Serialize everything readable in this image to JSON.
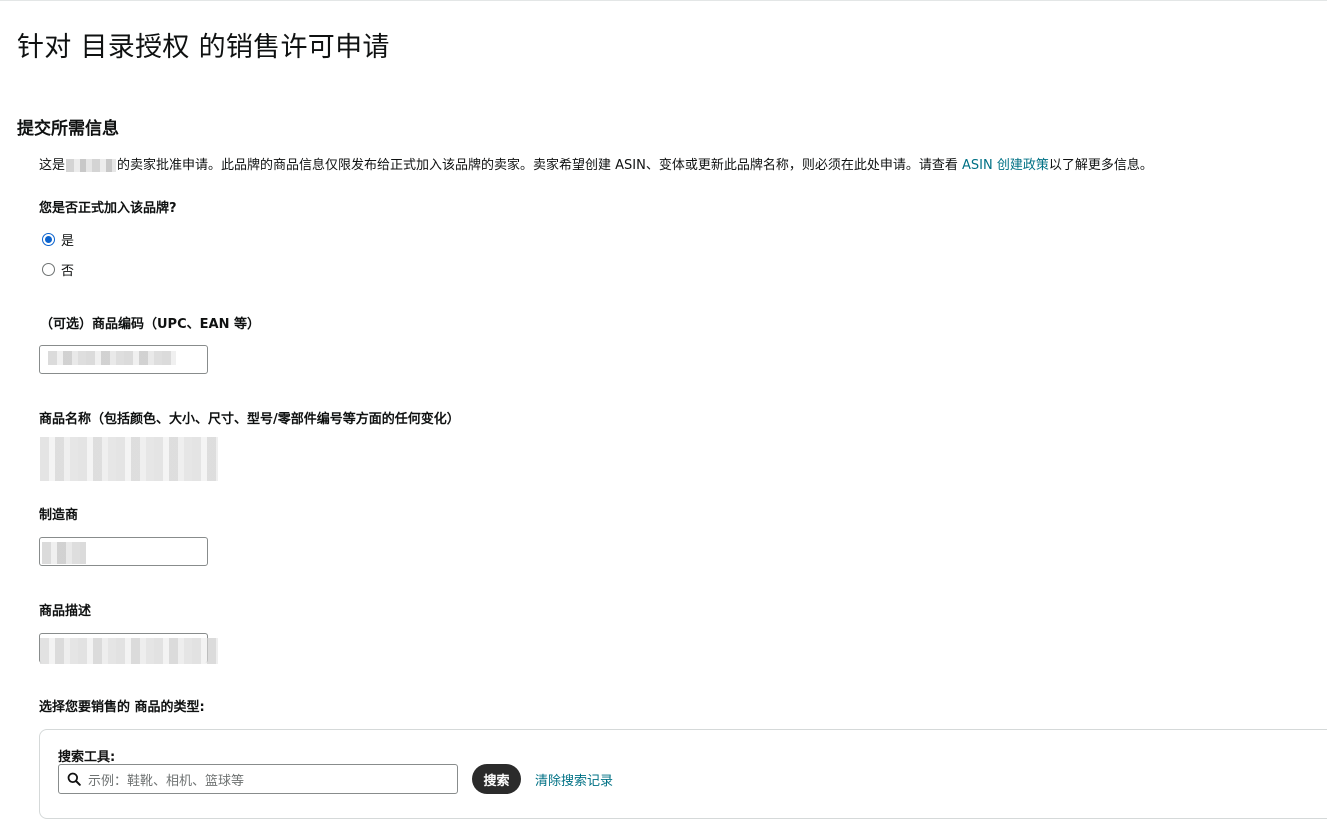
{
  "page": {
    "title": "针对 目录授权 的销售许可申请",
    "section_title": "提交所需信息"
  },
  "intro": {
    "prefix": "这是",
    "middle": "的卖家批准申请。此品牌的商品信息仅限发布给正式加入该品牌的卖家。卖家希望创建 ASIN、变体或更新此品牌名称，则必须在此处申请。请查看 ",
    "link_text": "ASIN 创建政策",
    "suffix": "以了解更多信息。"
  },
  "brand_question": {
    "label": "您是否正式加入该品牌?",
    "options": [
      {
        "label": "是",
        "checked": true
      },
      {
        "label": "否",
        "checked": false
      }
    ]
  },
  "fields": {
    "product_code_label": "（可选）商品编码（UPC、EAN 等）",
    "product_name_label": "商品名称（包括颜色、大小、尺寸、型号/零部件编号等方面的任何变化）",
    "manufacturer_label": "制造商",
    "description_label": "商品描述",
    "category_label": "选择您要销售的 商品的类型:"
  },
  "search": {
    "label": "搜索工具:",
    "placeholder": "示例：鞋靴、相机、篮球等",
    "button_label": "搜索",
    "clear_label": "清除搜索记录"
  },
  "colors": {
    "link": "#007185",
    "radio_checked": "#0b63ce",
    "search_button": "#2b2b2b"
  }
}
